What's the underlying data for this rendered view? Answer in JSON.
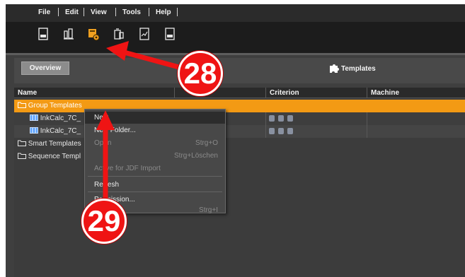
{
  "menubar": {
    "items": [
      "File",
      "Edit",
      "View",
      "Tools",
      "Help"
    ]
  },
  "toolbar": {
    "icons": [
      "abc-document-icon",
      "inking-icon",
      "templates-gear-icon",
      "job-icon",
      "chart-document-icon",
      "pdf-document-icon"
    ]
  },
  "header": {
    "overview_label": "Overview",
    "title": "Templates"
  },
  "table": {
    "columns": [
      "Name",
      "Criterion",
      "Machine"
    ],
    "rows": [
      {
        "name": "Group Templates",
        "selected": true
      },
      {
        "name": "InkCalc_7C_",
        "child": true
      },
      {
        "name": "InkCalc_7C_",
        "child": true
      },
      {
        "name": "Smart Templates"
      },
      {
        "name": "Sequence Templ"
      }
    ]
  },
  "context_menu": {
    "items": [
      {
        "label": "New",
        "shortcut": ""
      },
      {
        "label": "New Folder...",
        "shortcut": ""
      },
      {
        "label": "Open",
        "shortcut": "Strg+O"
      },
      {
        "label": "",
        "shortcut": "Strg+Löschen"
      },
      {
        "label": "Active for JDF Import",
        "shortcut": ""
      },
      {
        "label": "Refresh",
        "shortcut": ""
      },
      {
        "label": "Permission...",
        "shortcut": ""
      },
      {
        "label": "",
        "shortcut": "Strg+I"
      }
    ]
  },
  "callouts": {
    "step_28": "28",
    "step_29": "29"
  },
  "colors": {
    "accent": "#f39a14",
    "callout": "#ef1414"
  }
}
